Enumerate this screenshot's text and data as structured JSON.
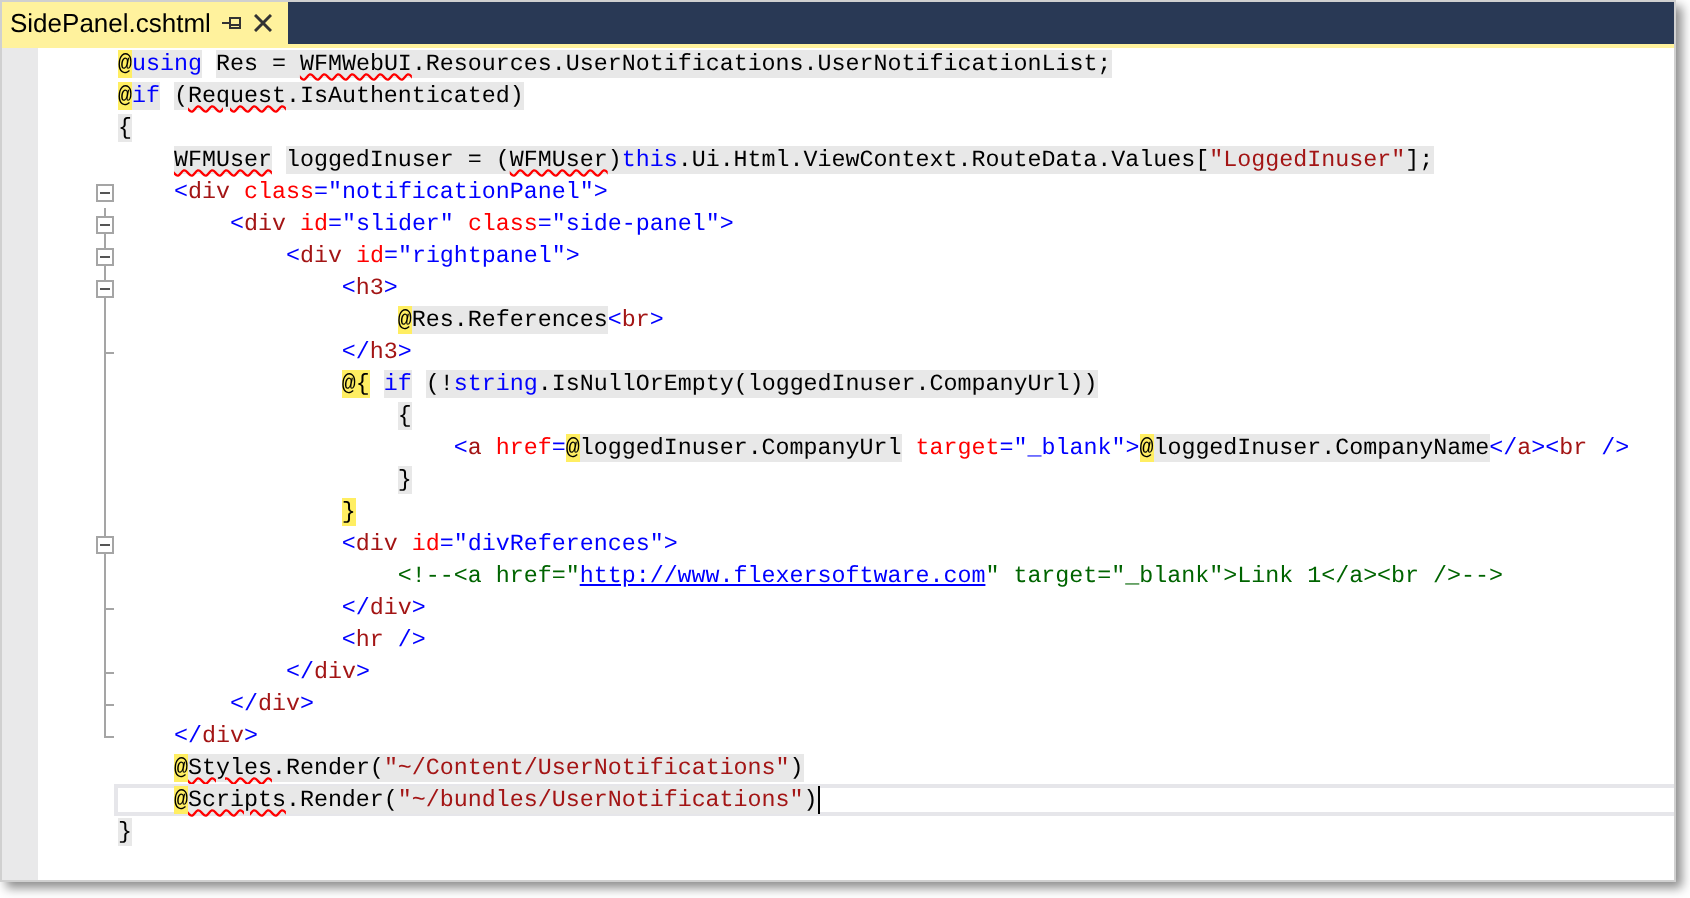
{
  "tab": {
    "title": "SidePanel.cshtml",
    "selected": true
  },
  "lines": [
    {
      "current": false,
      "tokens": [
        {
          "kind": "at",
          "t": "@",
          "sh": true
        },
        {
          "kind": "kw",
          "t": "using",
          "sh": true
        },
        {
          "kind": "plain",
          "t": " Res = ",
          "sh": true
        },
        {
          "kind": "err",
          "t": "WFMWebUI",
          "sh": true
        },
        {
          "kind": "plain",
          "t": ".Resources.UserNotifications.UserNotificationList;",
          "sh": true
        }
      ]
    },
    {
      "current": false,
      "tokens": [
        {
          "kind": "at",
          "t": "@",
          "sh": true
        },
        {
          "kind": "kw",
          "t": "if",
          "sh": true
        },
        {
          "kind": "plain",
          "t": " (",
          "sh": true
        },
        {
          "kind": "err",
          "t": "Request",
          "sh": true
        },
        {
          "kind": "plain",
          "t": ".IsAuthenticated)",
          "sh": true
        }
      ]
    },
    {
      "current": false,
      "tokens": [
        {
          "kind": "plain",
          "t": "{",
          "sh": true
        }
      ]
    },
    {
      "current": false,
      "tokens": [
        {
          "kind": "err",
          "t": "    WFMUser",
          "sh": true
        },
        {
          "kind": "plain",
          "t": " loggedInuser = (",
          "sh": true
        },
        {
          "kind": "err",
          "t": "WFMUser",
          "sh": true
        },
        {
          "kind": "plain",
          "t": ")",
          "sh": true
        },
        {
          "kind": "kw",
          "t": "this",
          "sh": true
        },
        {
          "kind": "plain",
          "t": ".Ui.Html.ViewContext.RouteData.Values[",
          "sh": true
        },
        {
          "kind": "cstr",
          "t": "\"LoggedInuser\"",
          "sh": true
        },
        {
          "kind": "plain",
          "t": "];",
          "sh": true
        }
      ]
    },
    {
      "current": false,
      "kind": "fold_start",
      "expanded": true,
      "tokens": [
        {
          "kind": "punct",
          "t": "    <",
          "sh": false
        },
        {
          "kind": "tag",
          "t": "div",
          "sh": false
        },
        {
          "kind": "attr",
          "t": " class",
          "sh": false
        },
        {
          "kind": "punct",
          "t": "=\"notificationPanel\">",
          "sh": false
        }
      ]
    },
    {
      "current": false,
      "kind": "fold_start",
      "expanded": true,
      "tokens": [
        {
          "kind": "punct",
          "t": "        <",
          "sh": false
        },
        {
          "kind": "tag",
          "t": "div",
          "sh": false
        },
        {
          "kind": "attr",
          "t": " id",
          "sh": false
        },
        {
          "kind": "punct",
          "t": "=\"slider\"",
          "sh": false
        },
        {
          "kind": "attr",
          "t": " class",
          "sh": false
        },
        {
          "kind": "punct",
          "t": "=\"side-panel\">",
          "sh": false
        }
      ]
    },
    {
      "current": false,
      "kind": "fold_start",
      "expanded": true,
      "tokens": [
        {
          "kind": "punct",
          "t": "            <",
          "sh": false
        },
        {
          "kind": "tag",
          "t": "div",
          "sh": false
        },
        {
          "kind": "attr",
          "t": " id",
          "sh": false
        },
        {
          "kind": "punct",
          "t": "=\"rightpanel\">",
          "sh": false
        }
      ]
    },
    {
      "current": false,
      "kind": "fold_start",
      "expanded": true,
      "tokens": [
        {
          "kind": "punct",
          "t": "                <",
          "sh": false
        },
        {
          "kind": "tag",
          "t": "h3",
          "sh": false
        },
        {
          "kind": "punct",
          "t": ">",
          "sh": false
        }
      ]
    },
    {
      "current": false,
      "tokens": [
        {
          "kind": "at",
          "t": "                    @",
          "sh": true
        },
        {
          "kind": "plain",
          "t": "Res.References",
          "sh": true
        },
        {
          "kind": "punct",
          "t": "<",
          "sh": false
        },
        {
          "kind": "tag",
          "t": "br",
          "sh": false
        },
        {
          "kind": "punct",
          "t": ">",
          "sh": false
        }
      ]
    },
    {
      "current": false,
      "kind": "fold_end",
      "tokens": [
        {
          "kind": "punct",
          "t": "                </",
          "sh": false
        },
        {
          "kind": "tag",
          "t": "h3",
          "sh": false
        },
        {
          "kind": "punct",
          "t": ">",
          "sh": false
        }
      ]
    },
    {
      "current": false,
      "tokens": [
        {
          "kind": "at",
          "t": "                @{",
          "sh": true
        },
        {
          "kind": "kw",
          "t": " if",
          "sh": true
        },
        {
          "kind": "plain",
          "t": " (!",
          "sh": true
        },
        {
          "kind": "kw",
          "t": "string",
          "sh": true
        },
        {
          "kind": "plain",
          "t": ".IsNullOrEmpty(loggedInuser.CompanyUrl))",
          "sh": true
        }
      ]
    },
    {
      "current": false,
      "tokens": [
        {
          "kind": "plain",
          "t": "                    {",
          "sh": true
        }
      ]
    },
    {
      "current": false,
      "tokens": [
        {
          "kind": "punct",
          "t": "                        <",
          "sh": false
        },
        {
          "kind": "tag",
          "t": "a",
          "sh": false
        },
        {
          "kind": "attr",
          "t": " href",
          "sh": false
        },
        {
          "kind": "punct",
          "t": "=",
          "sh": false
        },
        {
          "kind": "at",
          "t": "@",
          "sh": true
        },
        {
          "kind": "plain",
          "t": "loggedInuser.CompanyUrl",
          "sh": true
        },
        {
          "kind": "attr",
          "t": " target",
          "sh": false
        },
        {
          "kind": "punct",
          "t": "=\"_blank\">",
          "sh": false
        },
        {
          "kind": "at",
          "t": "@",
          "sh": true
        },
        {
          "kind": "plain",
          "t": "loggedInuser.CompanyName",
          "sh": true
        },
        {
          "kind": "punct",
          "t": "</",
          "sh": false
        },
        {
          "kind": "tag",
          "t": "a",
          "sh": false
        },
        {
          "kind": "punct",
          "t": "><",
          "sh": false
        },
        {
          "kind": "tag",
          "t": "br",
          "sh": false
        },
        {
          "kind": "punct",
          "t": " />",
          "sh": false
        }
      ]
    },
    {
      "current": false,
      "tokens": [
        {
          "kind": "plain",
          "t": "                    }",
          "sh": true
        }
      ]
    },
    {
      "current": false,
      "tokens": [
        {
          "kind": "at",
          "t": "                }",
          "sh": true
        }
      ]
    },
    {
      "current": false,
      "kind": "fold_start",
      "expanded": true,
      "tokens": [
        {
          "kind": "punct",
          "t": "                <",
          "sh": false
        },
        {
          "kind": "tag",
          "t": "div",
          "sh": false
        },
        {
          "kind": "attr",
          "t": " id",
          "sh": false
        },
        {
          "kind": "punct",
          "t": "=\"divReferences\">",
          "sh": false
        }
      ]
    },
    {
      "current": false,
      "tokens": [
        {
          "kind": "comment",
          "t": "                    <!--<a href=\"",
          "sh": false
        },
        {
          "kind": "link",
          "t": "http://www.flexersoftware.com",
          "sh": false
        },
        {
          "kind": "comment",
          "t": "\" target=\"_blank\">Link 1</a><br />-->",
          "sh": false
        }
      ]
    },
    {
      "current": false,
      "kind": "fold_end",
      "tokens": [
        {
          "kind": "punct",
          "t": "                </",
          "sh": false
        },
        {
          "kind": "tag",
          "t": "div",
          "sh": false
        },
        {
          "kind": "punct",
          "t": ">",
          "sh": false
        }
      ]
    },
    {
      "current": false,
      "tokens": [
        {
          "kind": "punct",
          "t": "                <",
          "sh": false
        },
        {
          "kind": "tag",
          "t": "hr",
          "sh": false
        },
        {
          "kind": "punct",
          "t": " />",
          "sh": false
        }
      ]
    },
    {
      "current": false,
      "kind": "fold_end",
      "tokens": [
        {
          "kind": "punct",
          "t": "            </",
          "sh": false
        },
        {
          "kind": "tag",
          "t": "div",
          "sh": false
        },
        {
          "kind": "punct",
          "t": ">",
          "sh": false
        }
      ]
    },
    {
      "current": false,
      "kind": "fold_end",
      "tokens": [
        {
          "kind": "punct",
          "t": "        </",
          "sh": false
        },
        {
          "kind": "tag",
          "t": "div",
          "sh": false
        },
        {
          "kind": "punct",
          "t": ">",
          "sh": false
        }
      ]
    },
    {
      "current": false,
      "kind": "fold_end",
      "tokens": [
        {
          "kind": "punct",
          "t": "    </",
          "sh": false
        },
        {
          "kind": "tag",
          "t": "div",
          "sh": false
        },
        {
          "kind": "punct",
          "t": ">",
          "sh": false
        }
      ]
    },
    {
      "current": false,
      "tokens": [
        {
          "kind": "at",
          "t": "    @",
          "sh": true
        },
        {
          "kind": "err",
          "t": "Styles",
          "sh": true
        },
        {
          "kind": "plain",
          "t": ".Render(",
          "sh": true
        },
        {
          "kind": "cstr",
          "t": "\"~/Content/UserNotifications\"",
          "sh": true
        },
        {
          "kind": "plain",
          "t": ")",
          "sh": true
        }
      ]
    },
    {
      "current": true,
      "tokens": [
        {
          "kind": "at",
          "t": "    @",
          "sh": true
        },
        {
          "kind": "err",
          "t": "Scripts",
          "sh": true
        },
        {
          "kind": "plain",
          "t": ".Render(",
          "sh": true
        },
        {
          "kind": "cstr",
          "t": "\"~/bundles/UserNotifications\"",
          "sh": true
        },
        {
          "kind": "plain",
          "t": ")",
          "sh": true
        }
      ]
    },
    {
      "current": false,
      "tokens": [
        {
          "kind": "plain",
          "t": "}",
          "sh": true
        }
      ]
    }
  ]
}
